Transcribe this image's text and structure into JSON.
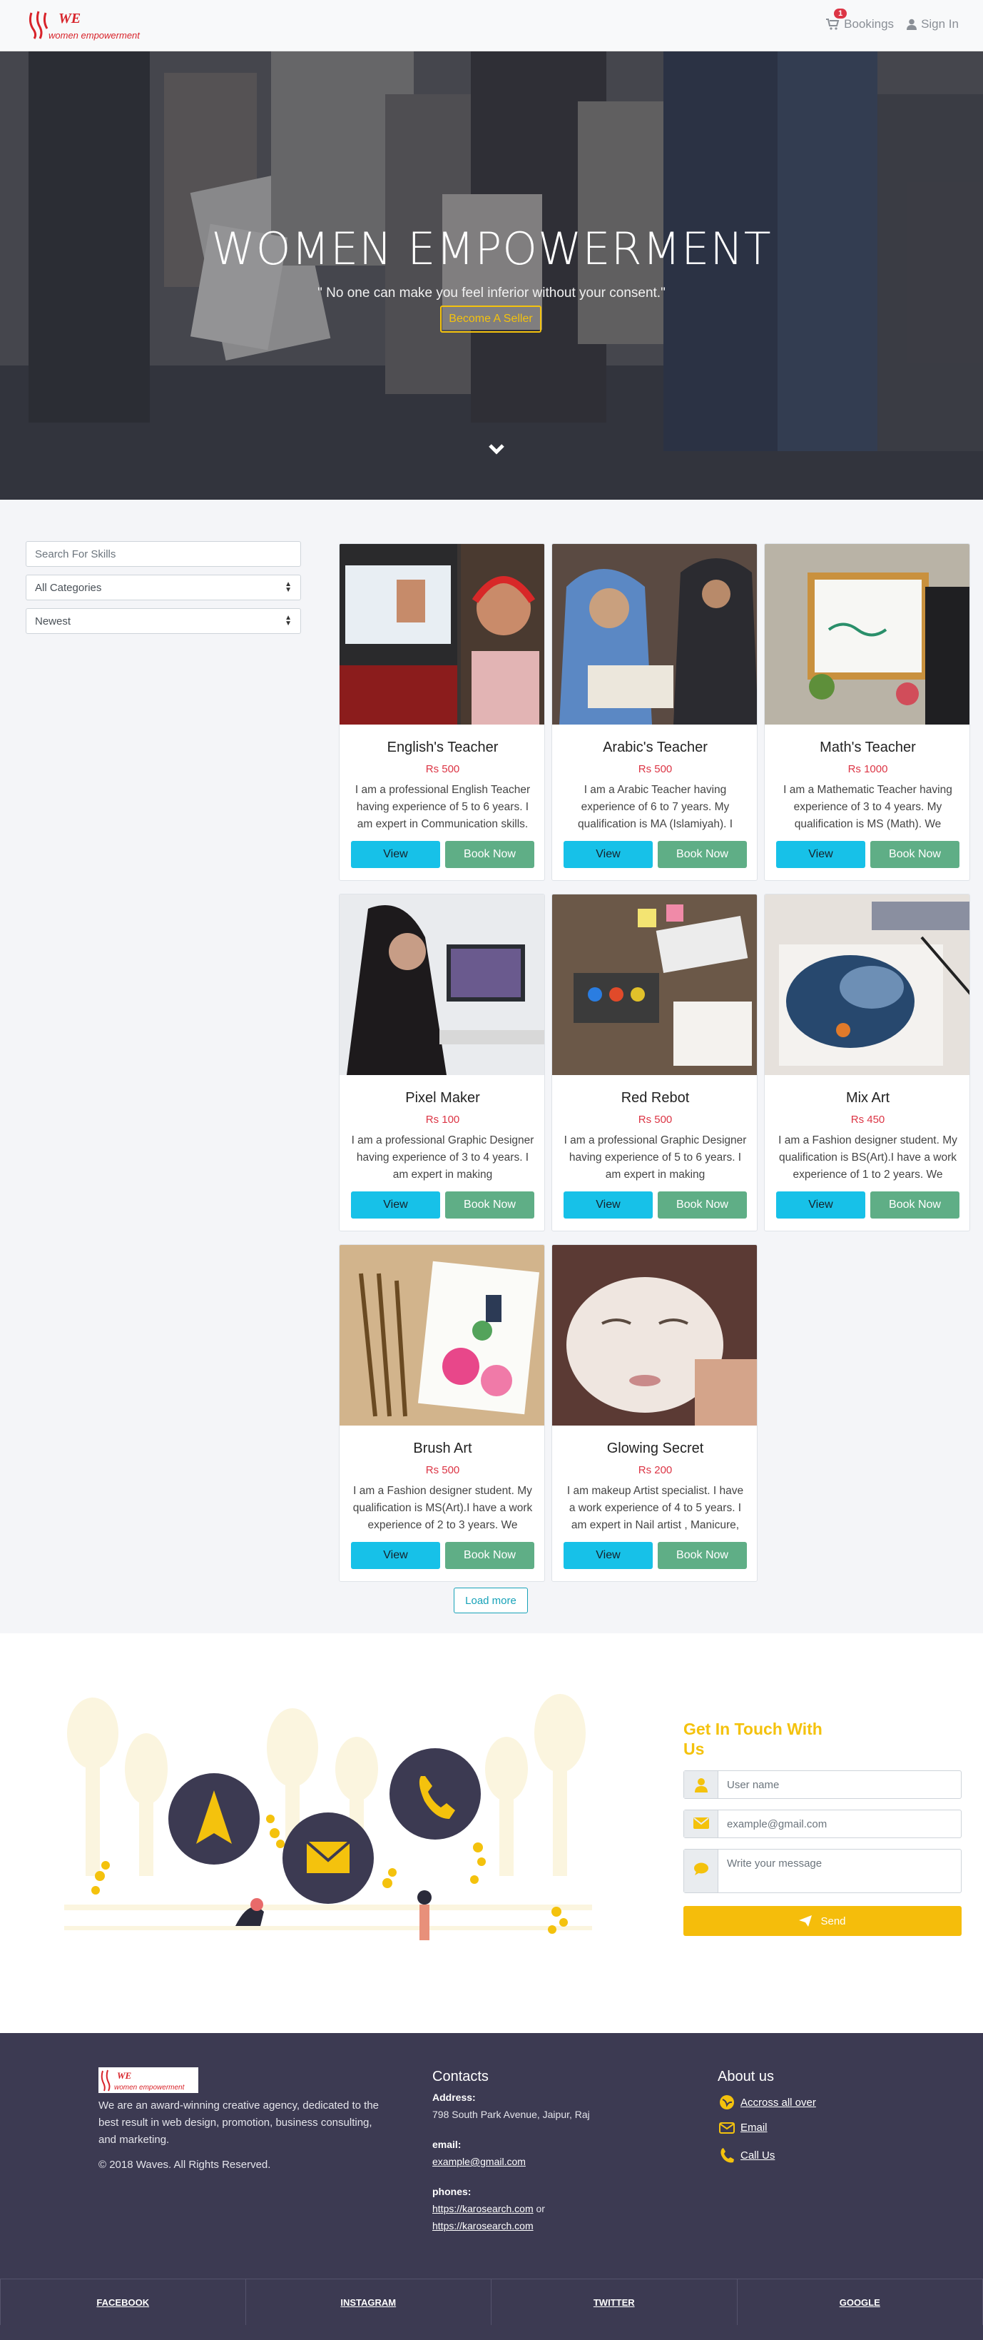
{
  "nav": {
    "logo_text": "women empowerment",
    "bookings_label": "Bookings",
    "bookings_count": "1",
    "signin_label": "Sign In"
  },
  "hero": {
    "title": "WOMEN EMPOWERMENT",
    "quote": "\" No one can make you feel inferior without your consent.\"",
    "button_label": "Become A Seller"
  },
  "filters": {
    "search_placeholder": "Search For Skills",
    "category_value": "All Categories",
    "sort_value": "Newest"
  },
  "cards": [
    {
      "title": "English's Teacher",
      "price": "Rs 500",
      "desc": "I am a professional English Teacher having experience of 5 to 6 years. I am expert in Communication skills.",
      "view": "View",
      "book": "Book Now"
    },
    {
      "title": "Arabic's Teacher",
      "price": "Rs 500",
      "desc": "I am a Arabic Teacher having experience of 6 to 7 years. My qualification is MA (Islamiyah). I",
      "view": "View",
      "book": "Book Now"
    },
    {
      "title": "Math's Teacher",
      "price": "Rs 1000",
      "desc": "I am a Mathematic Teacher having experience of 3 to 4 years. My qualification is MS (Math). We",
      "view": "View",
      "book": "Book Now"
    },
    {
      "title": "Pixel Maker",
      "price": "Rs 100",
      "desc": "I am a professional Graphic Designer having experience of 3 to 4 years. I am expert in making",
      "view": "View",
      "book": "Book Now"
    },
    {
      "title": "Red Rebot",
      "price": "Rs 500",
      "desc": "I am a professional Graphic Designer having experience of 5 to 6 years. I am expert in making",
      "view": "View",
      "book": "Book Now"
    },
    {
      "title": "Mix Art",
      "price": "Rs 450",
      "desc": "I am a Fashion designer student. My qualification is BS(Art).I have a work experience of 1 to 2 years. We",
      "view": "View",
      "book": "Book Now"
    },
    {
      "title": "Brush Art",
      "price": "Rs 500",
      "desc": "I am a Fashion designer student. My qualification is MS(Art).I have a work experience of 2 to 3 years. We",
      "view": "View",
      "book": "Book Now"
    },
    {
      "title": "Glowing Secret",
      "price": "Rs 200",
      "desc": "I am makeup Artist specialist. I have a work experience of 4 to 5 years. I am expert in Nail artist , Manicure,",
      "view": "View",
      "book": "Book Now"
    }
  ],
  "load_more": "Load more",
  "contact": {
    "title": "Get In Touch With Us",
    "name_placeholder": "User name",
    "email_placeholder": "example@gmail.com",
    "message_placeholder": "Write your message",
    "send_label": "Send",
    "accent_color": "#f5bd0b"
  },
  "footer": {
    "logo_text": "women empowerment",
    "about_text": "We are an award-winning creative agency, dedicated to the best result in web design, promotion, business consulting, and marketing.",
    "copyright": "©  2018 Waves. All Rights Reserved.",
    "contacts_title": "Contacts",
    "address_label": "Address:",
    "address_value": "798 South Park Avenue, Jaipur, Raj",
    "email_label": "email:",
    "email_value": "example@gmail.com",
    "phones_label": "phones:",
    "phone_1": "https://karosearch.com",
    "phone_or": "or",
    "phone_2": "https://karosearch.com",
    "about_title": "About us",
    "about_links": [
      "Accross all over",
      "Email",
      "Call Us"
    ],
    "social": [
      "FACEBOOK",
      "INSTAGRAM",
      "TWITTER",
      "GOOGLE"
    ]
  }
}
